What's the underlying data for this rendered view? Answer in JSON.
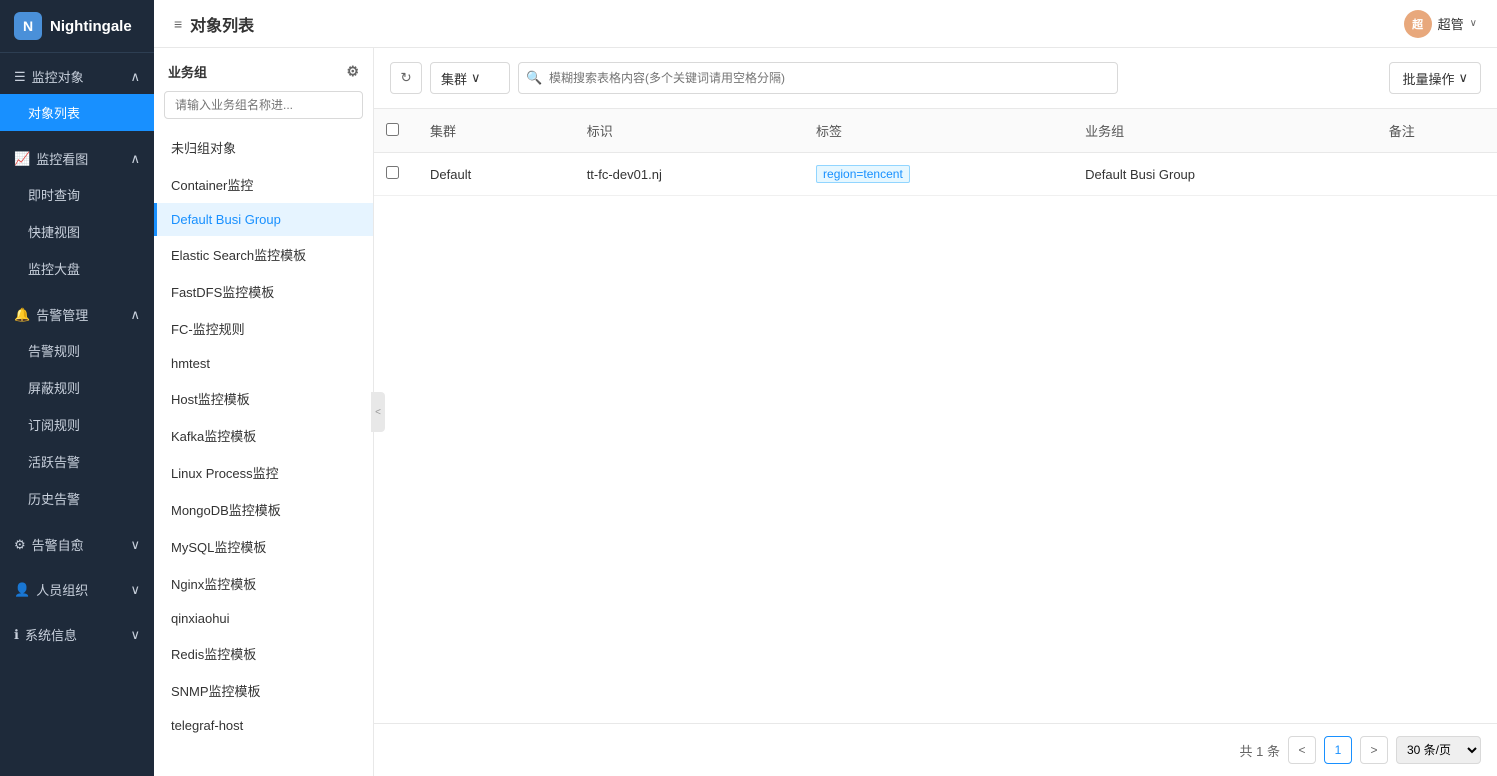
{
  "app": {
    "logo_text": "Nightingale",
    "logo_abbr": "N"
  },
  "topbar": {
    "title": "对象列表",
    "title_icon": "≡",
    "user_name": "超管",
    "user_abbr": "超"
  },
  "sidebar": {
    "groups": [
      {
        "id": "monitoring",
        "label": "监控对象",
        "icon": "☰",
        "expanded": true,
        "items": [
          {
            "id": "object-list",
            "label": "对象列表",
            "active": true
          }
        ]
      },
      {
        "id": "monitor-view",
        "label": "监控看图",
        "icon": "📈",
        "expanded": true,
        "items": [
          {
            "id": "realtime",
            "label": "即时查询",
            "active": false
          },
          {
            "id": "quick-view",
            "label": "快捷视图",
            "active": false
          },
          {
            "id": "dashboard",
            "label": "监控大盘",
            "active": false
          }
        ]
      },
      {
        "id": "alert-mgmt",
        "label": "告警管理",
        "icon": "🔔",
        "expanded": true,
        "items": [
          {
            "id": "alert-rules",
            "label": "告警规则",
            "active": false
          },
          {
            "id": "silence-rules",
            "label": "屏蔽规则",
            "active": false
          },
          {
            "id": "subscribe-rules",
            "label": "订阅规则",
            "active": false
          },
          {
            "id": "active-alerts",
            "label": "活跃告警",
            "active": false
          },
          {
            "id": "history-alerts",
            "label": "历史告警",
            "active": false
          }
        ]
      },
      {
        "id": "alert-self",
        "label": "告警自愈",
        "icon": "⚙",
        "expanded": false,
        "items": []
      },
      {
        "id": "personnel",
        "label": "人员组织",
        "icon": "👤",
        "expanded": false,
        "items": []
      },
      {
        "id": "system-info",
        "label": "系统信息",
        "icon": "ℹ",
        "expanded": false,
        "items": []
      }
    ]
  },
  "biz_sidebar": {
    "title": "业务组",
    "search_placeholder": "请输入业务组名称进...",
    "items": [
      {
        "id": "ungrouped",
        "label": "未归组对象",
        "active": false
      },
      {
        "id": "container",
        "label": "Container监控",
        "active": false
      },
      {
        "id": "default-busi",
        "label": "Default Busi Group",
        "active": true
      },
      {
        "id": "elastic",
        "label": "Elastic Search监控模板",
        "active": false
      },
      {
        "id": "fastdfs",
        "label": "FastDFS监控模板",
        "active": false
      },
      {
        "id": "fc-rules",
        "label": "FC-监控规则",
        "active": false
      },
      {
        "id": "hmtest",
        "label": "hmtest",
        "active": false
      },
      {
        "id": "host",
        "label": "Host监控模板",
        "active": false
      },
      {
        "id": "kafka",
        "label": "Kafka监控模板",
        "active": false
      },
      {
        "id": "linux-process",
        "label": "Linux Process监控",
        "active": false
      },
      {
        "id": "mongodb",
        "label": "MongoDB监控模板",
        "active": false
      },
      {
        "id": "mysql",
        "label": "MySQL监控模板",
        "active": false
      },
      {
        "id": "nginx",
        "label": "Nginx监控模板",
        "active": false
      },
      {
        "id": "qinxiaohui",
        "label": "qinxiaohui",
        "active": false
      },
      {
        "id": "redis",
        "label": "Redis监控模板",
        "active": false
      },
      {
        "id": "snmp",
        "label": "SNMP监控模板",
        "active": false
      },
      {
        "id": "telegraf-host",
        "label": "telegraf-host",
        "active": false
      }
    ]
  },
  "table": {
    "toolbar": {
      "refresh_label": "⟳",
      "cluster_label": "集群",
      "search_placeholder": "模糊搜索表格内容(多个关键词请用空格分隔)",
      "batch_label": "批量操作"
    },
    "columns": [
      {
        "id": "checkbox",
        "label": ""
      },
      {
        "id": "cluster",
        "label": "集群"
      },
      {
        "id": "ident",
        "label": "标识"
      },
      {
        "id": "tags",
        "label": "标签"
      },
      {
        "id": "biz-group",
        "label": "业务组"
      },
      {
        "id": "remark",
        "label": "备注"
      }
    ],
    "rows": [
      {
        "cluster": "Default",
        "ident": "tt-fc-dev01.nj",
        "tags": [
          "region=tencent"
        ],
        "biz_group": "Default Busi Group",
        "remark": ""
      }
    ],
    "pagination": {
      "total_text": "共 1 条",
      "current_page": "1",
      "page_size_label": "30 条/页"
    }
  }
}
